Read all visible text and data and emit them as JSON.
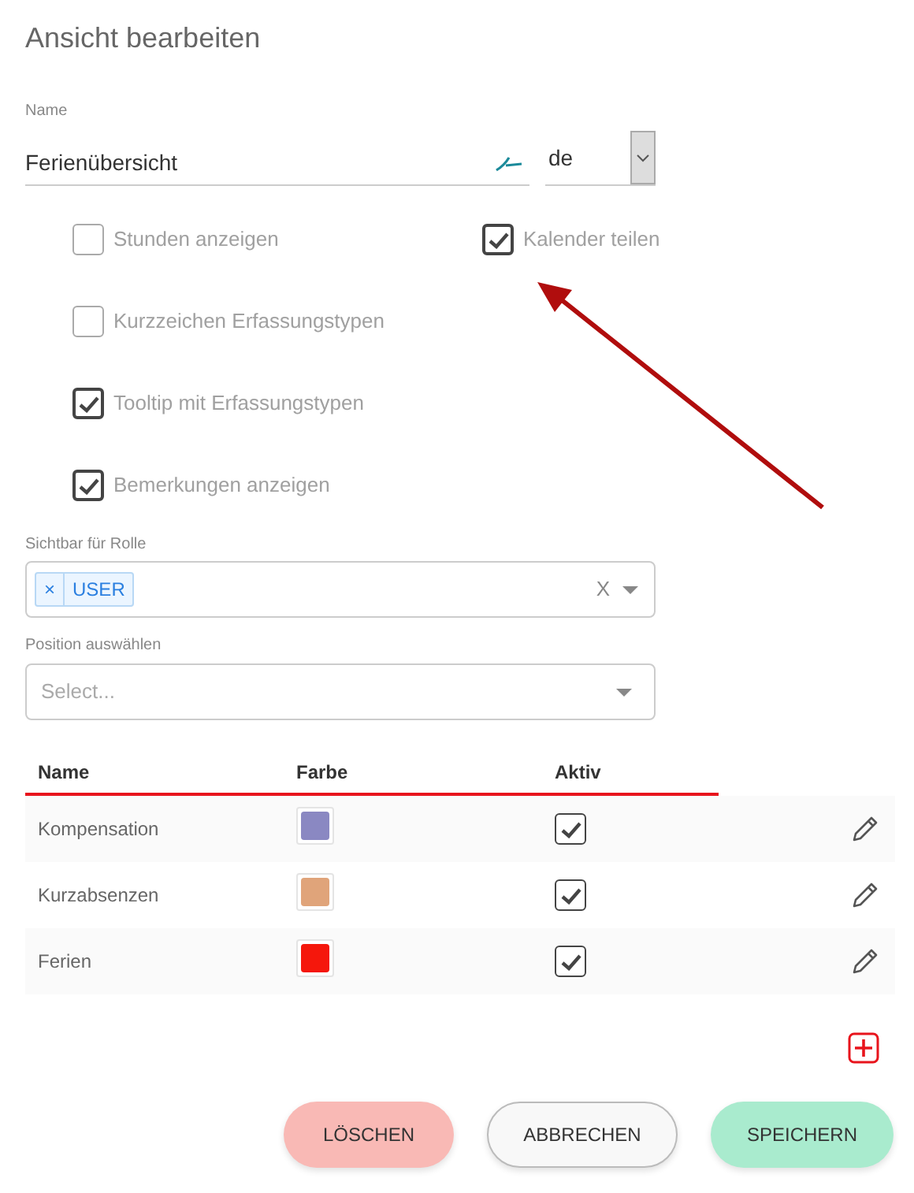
{
  "title": "Ansicht bearbeiten",
  "name_field": {
    "label": "Name",
    "value": "Ferienübersicht",
    "language": "de"
  },
  "option_rows": [
    [
      {
        "label": "Stunden anzeigen",
        "checked": false
      },
      {
        "label": "Kalender teilen",
        "checked": true
      }
    ],
    [
      {
        "label": "Kurzzeichen Erfassungstypen",
        "checked": false
      }
    ],
    [
      {
        "label": "Tooltip mit Erfassungstypen",
        "checked": true
      }
    ],
    [
      {
        "label": "Bemerkungen anzeigen",
        "checked": true
      }
    ]
  ],
  "role_field": {
    "label": "Sichtbar für Rolle",
    "tags": [
      {
        "remove": "×",
        "label": "USER"
      }
    ],
    "clear": "X"
  },
  "position_field": {
    "label": "Position auswählen",
    "placeholder": "Select..."
  },
  "table": {
    "columns": [
      "Name",
      "Farbe",
      "Aktiv"
    ],
    "rows": [
      {
        "name": "Kompensation",
        "color": "#8a88c2",
        "active": true
      },
      {
        "name": "Kurzabsenzen",
        "color": "#e0a47a",
        "active": true
      },
      {
        "name": "Ferien",
        "color": "#f5170c",
        "active": true
      }
    ]
  },
  "buttons": [
    {
      "kind": "delete",
      "label": "LÖSCHEN"
    },
    {
      "kind": "cancel",
      "label": "ABBRECHEN"
    },
    {
      "kind": "save",
      "label": "SPEICHERN"
    }
  ]
}
